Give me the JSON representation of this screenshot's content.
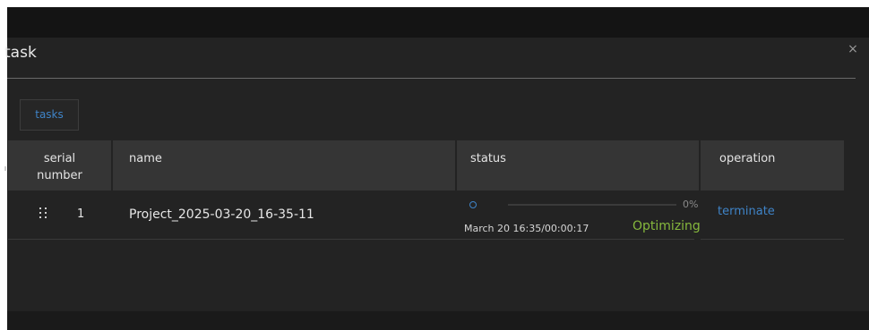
{
  "dialog": {
    "title": "task",
    "close_glyph": "×"
  },
  "tabs": [
    {
      "label": "tasks",
      "active": true
    }
  ],
  "table": {
    "columns": [
      "serial\nnumber",
      "name",
      "status",
      "operation"
    ],
    "column_labels": {
      "serial": "serial number",
      "name": "name",
      "status": "status",
      "operation": "operation"
    },
    "rows": [
      {
        "serial": "1",
        "name": "Project_2025-03-20_16-35-11",
        "progress_percent": 0,
        "progress_label": "0%",
        "time": "March 20 16:35/00:00:17",
        "status": "Optimizing",
        "operation": "terminate"
      }
    ]
  },
  "icons": {
    "drag_handle": "drag-handle-icon",
    "progress_indicator": "progress-dot-icon",
    "close": "close-icon"
  },
  "colors": {
    "background": "#232323",
    "header_background": "#353535",
    "accent_blue": "#3f84c8",
    "status_green": "#86b83d",
    "text": "#e6e6e6"
  }
}
